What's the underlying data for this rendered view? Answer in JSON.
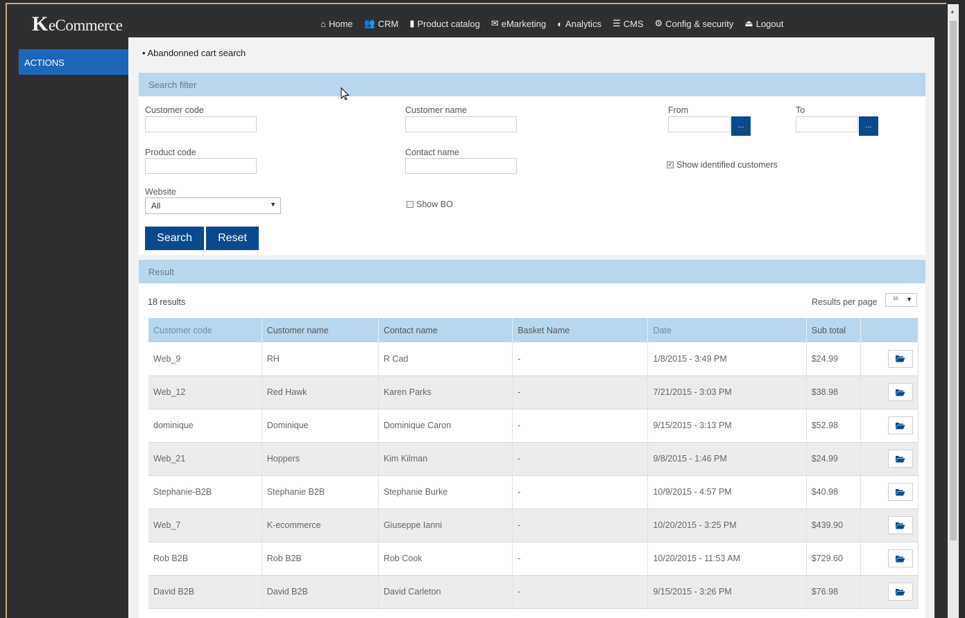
{
  "app": {
    "logo_mark": "K",
    "logo_text": "eCommerce"
  },
  "nav": [
    {
      "label": "Home",
      "icon": "home-icon",
      "glyph": "⌂"
    },
    {
      "label": "CRM",
      "icon": "users-icon",
      "glyph": "👥"
    },
    {
      "label": "Product catalog",
      "icon": "book-icon",
      "glyph": "▮"
    },
    {
      "label": "eMarketing",
      "icon": "envelope-icon",
      "glyph": "✉"
    },
    {
      "label": "Analytics",
      "icon": "pie-chart-icon",
      "glyph": "◐"
    },
    {
      "label": "CMS",
      "icon": "list-icon",
      "glyph": "☰"
    },
    {
      "label": "Config & security",
      "icon": "gear-icon",
      "glyph": "⚙"
    },
    {
      "label": "Logout",
      "icon": "logout-icon",
      "glyph": "⏏"
    }
  ],
  "sidebar": {
    "actions_label": "ACTIONS"
  },
  "page": {
    "title": "Abandonned cart search",
    "bullet": "•"
  },
  "filter": {
    "header": "Search filter",
    "customer_code_label": "Customer code",
    "customer_code_value": "",
    "customer_name_label": "Customer name",
    "customer_name_value": "",
    "from_label": "From",
    "from_value": "",
    "to_label": "To",
    "to_value": "",
    "dots": "...",
    "product_code_label": "Product code",
    "product_code_value": "",
    "contact_name_label": "Contact name",
    "contact_name_value": "",
    "show_identified_label": "Show identified customers",
    "show_identified_checked": true,
    "website_label": "Website",
    "website_value": "All",
    "show_bo_label": "Show BO",
    "show_bo_checked": false,
    "search_button": "Search",
    "reset_button": "Reset"
  },
  "result": {
    "header": "Result",
    "count_text": "18 results",
    "per_page_label": "Results per page",
    "per_page_value": "10",
    "columns": [
      "Customer code",
      "Customer name",
      "Contact name",
      "Basket Name",
      "Date",
      "Sub total",
      ""
    ],
    "rows": [
      {
        "customer_code": "Web_9",
        "customer_name": "RH",
        "contact_name": "R Cad",
        "basket_name": "-",
        "date": "1/8/2015 - 3:49 PM",
        "sub_total": "$24.99"
      },
      {
        "customer_code": "Web_12",
        "customer_name": "Red Hawk",
        "contact_name": "Karen Parks",
        "basket_name": "-",
        "date": "7/21/2015 - 3:03 PM",
        "sub_total": "$38.98"
      },
      {
        "customer_code": "dominique",
        "customer_name": "Dominique",
        "contact_name": "Dominique Caron",
        "basket_name": "-",
        "date": "9/15/2015 - 3:13 PM",
        "sub_total": "$52.98"
      },
      {
        "customer_code": "Web_21",
        "customer_name": "Hoppers",
        "contact_name": "Kim Kilman",
        "basket_name": "-",
        "date": "9/8/2015 - 1:46 PM",
        "sub_total": "$24.99"
      },
      {
        "customer_code": "Stephanie-B2B",
        "customer_name": "Stephanie B2B",
        "contact_name": "Stephanie Burke",
        "basket_name": "-",
        "date": "10/9/2015 - 4:57 PM",
        "sub_total": "$40.98"
      },
      {
        "customer_code": "Web_7",
        "customer_name": "K-ecommerce",
        "contact_name": "Giuseppe Ianni",
        "basket_name": "-",
        "date": "10/20/2015 - 3:25 PM",
        "sub_total": "$439.90"
      },
      {
        "customer_code": "Rob B2B",
        "customer_name": "Rob B2B",
        "contact_name": "Rob Cook",
        "basket_name": "-",
        "date": "10/20/2015 - 11:53 AM",
        "sub_total": "$729.60"
      },
      {
        "customer_code": "David B2B",
        "customer_name": "David B2B",
        "contact_name": "David Carleton",
        "basket_name": "-",
        "date": "9/15/2015 - 3:26 PM",
        "sub_total": "$76.98"
      }
    ]
  },
  "colors": {
    "accent": "#1e66b8",
    "button": "#0a4a8c",
    "panel_header": "#b8d6ec",
    "chrome": "#2e2f31"
  }
}
